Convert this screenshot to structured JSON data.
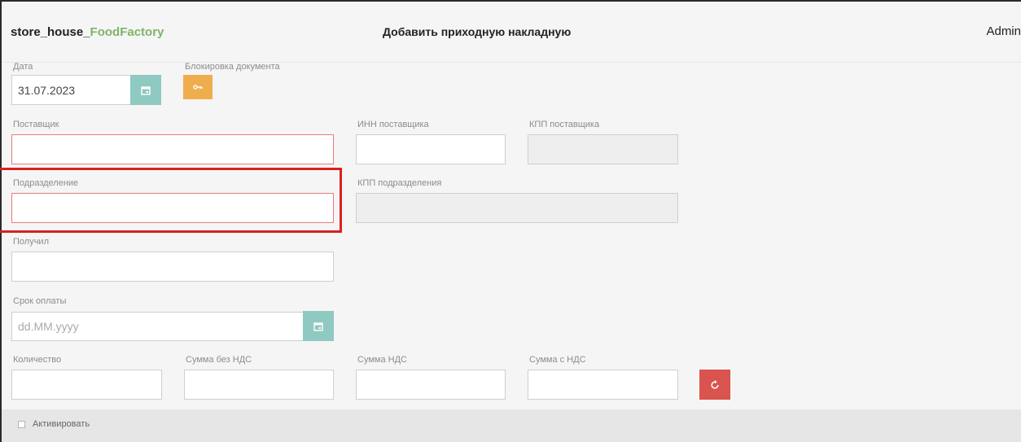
{
  "header": {
    "brand_prefix": "store_house_",
    "brand_highlight": "FoodFactory",
    "title": "Добавить приходную накладную",
    "user": "Admin"
  },
  "form": {
    "date": {
      "label": "Дата",
      "value": "31.07.2023",
      "icon": "calendar-icon"
    },
    "lock": {
      "label": "Блокировка документа",
      "icon": "key-icon"
    },
    "supplier": {
      "label": "Поставщик",
      "value": ""
    },
    "supplier_inn": {
      "label": "ИНН поставщика",
      "value": ""
    },
    "supplier_kpp": {
      "label": "КПП поставщика",
      "value": ""
    },
    "division": {
      "label": "Подразделение",
      "value": ""
    },
    "division_kpp": {
      "label": "КПП подразделения",
      "value": ""
    },
    "received_by": {
      "label": "Получил",
      "value": ""
    },
    "payment_due": {
      "label": "Срок оплаты",
      "placeholder": "dd.MM.yyyy",
      "icon": "calendar-icon"
    },
    "quantity": {
      "label": "Количество",
      "value": ""
    },
    "sum_no_vat": {
      "label": "Сумма без НДС",
      "value": ""
    },
    "vat_sum": {
      "label": "Сумма НДС",
      "value": ""
    },
    "sum_with_vat": {
      "label": "Сумма с НДС",
      "value": ""
    },
    "reset": {
      "icon": "reset-icon"
    },
    "activate": {
      "label": "Активировать",
      "checked": false
    }
  },
  "colors": {
    "brand_accent": "#7fb36b",
    "calendar_button": "#8ec9c2",
    "lock_button": "#f0ad4e",
    "reset_button": "#d9534f",
    "error_border": "#e87b7b",
    "highlight": "#d92121"
  }
}
